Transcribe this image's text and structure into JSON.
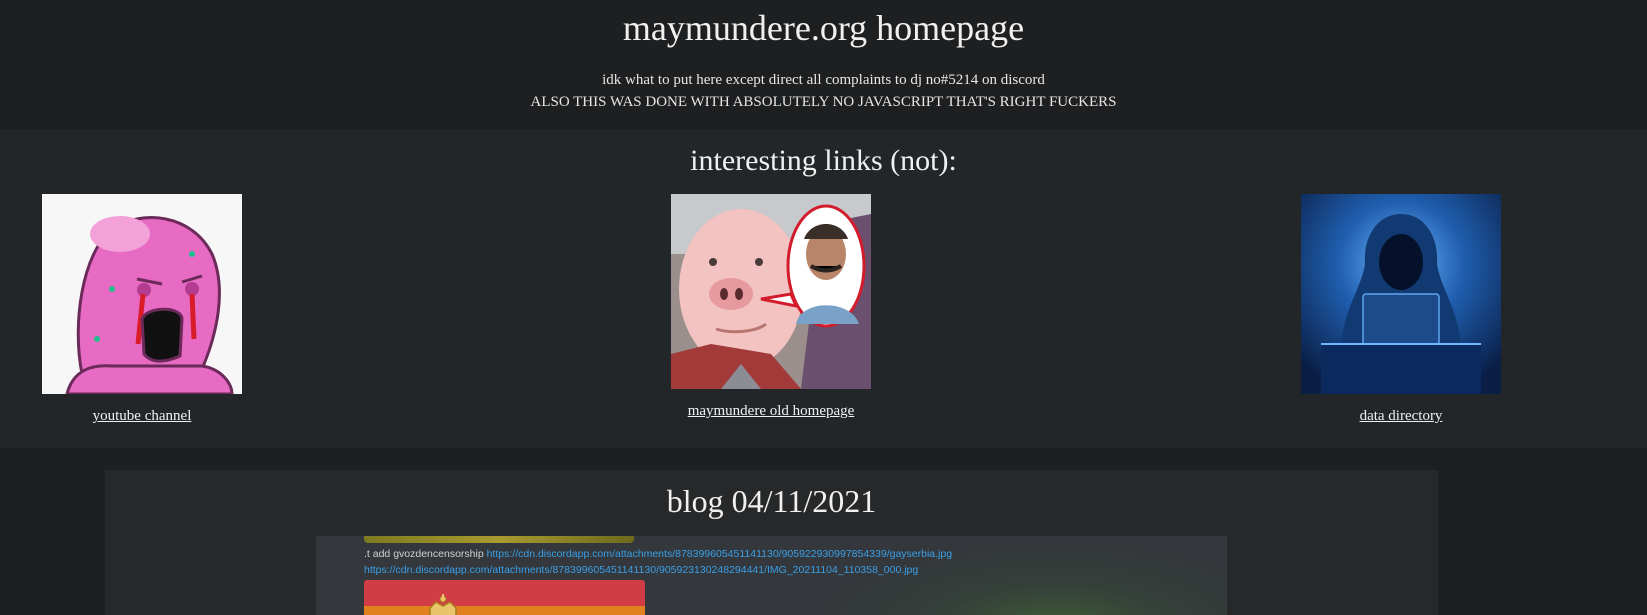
{
  "header": {
    "title": "maymundere.org homepage",
    "tagline_1": "idk what to put here except direct all complaints to dj no#5214 on discord",
    "tagline_2": "ALSO THIS WAS DONE WITH ABSOLUTELY NO JAVASCRIPT THAT'S RIGHT FUCKERS"
  },
  "links": {
    "heading": "interesting links (not):",
    "items": [
      {
        "label": "youtube channel",
        "image": "crying-pink-wojak-image"
      },
      {
        "label": "maymundere old homepage",
        "image": "pig-face-with-speech-bubble-image"
      },
      {
        "label": "data directory",
        "image": "hooded-hacker-laptop-image"
      }
    ]
  },
  "blog": {
    "title": "blog 04/11/2021",
    "screenshot": {
      "line_1_prefix": ".t add gvozdencensorship ",
      "line_1_link": "https://cdn.discordapp.com/attachments/878399605451141130/905922930997854339/gayserbia.jpg",
      "line_2_link": "https://cdn.discordapp.com/attachments/878399605451141130/905923130248294441/IMG_20211104_110358_000.jpg"
    }
  },
  "colors": {
    "background": "#1e1f21",
    "links_section": "#232628",
    "blog_section": "#262829",
    "discord_link": "#3aa0e8"
  }
}
